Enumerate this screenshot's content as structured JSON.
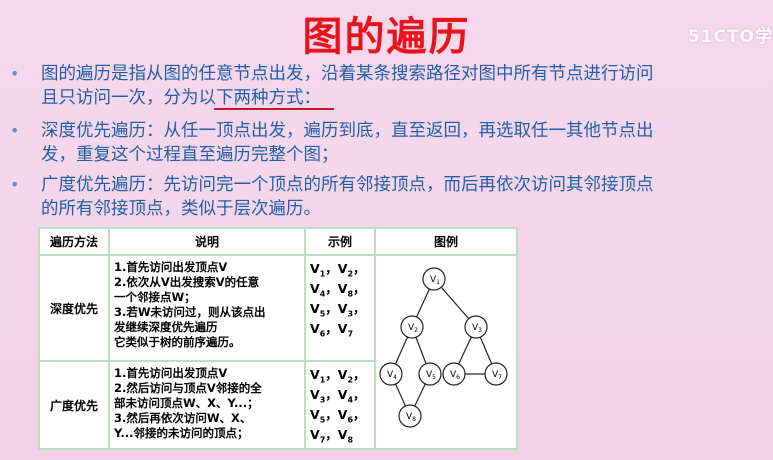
{
  "title": "图的遍历",
  "watermark": "51CTO学",
  "bullets": [
    {
      "line1": "图的遍历是指从图的任意节点出发，沿着某条搜索路径对图中所有节点进行访问",
      "line2": "且只访问一次，分为以下两种方式："
    },
    {
      "line1": "深度优先遍历：从任一顶点出发，遍历到底，直至返回，再选取任一其他节点出",
      "line2": "发，重复这个过程直至遍历完整个图；"
    },
    {
      "line1": "广度优先遍历：先访问完一个顶点的所有邻接顶点，而后再依次访问其邻接顶点",
      "line2": "的所有邻接顶点，类似于层次遍历。"
    }
  ],
  "table": {
    "headers": [
      "遍历方法",
      "说明",
      "示例",
      "图例"
    ],
    "rows": [
      {
        "method": "深度优先",
        "desc": [
          "1.首先访问出发顶点V",
          "2.依次从V出发搜索V的任意",
          "一个邻接点W；",
          "3.若W未访问过，则从该点出",
          "发继续深度优先遍历",
          "它类似于树的前序遍历。"
        ],
        "example": [
          "V1，V2，",
          "V4，V8，",
          "V5，V3，",
          "V6，V7"
        ]
      },
      {
        "method": "广度优先",
        "desc": [
          "1.首先访问出发顶点V",
          "2.然后访问与顶点V邻接的全",
          "部未访问顶点W、X、Y...；",
          "3.然后再依次访问W、X、",
          "Y...邻接的未访问的顶点；"
        ],
        "example": [
          "V1，V2，",
          "V3，V4，",
          "V5，V6，",
          "V7，V8"
        ]
      }
    ]
  },
  "graph": {
    "nodes": [
      {
        "id": "V1",
        "base": "V",
        "sub": "1"
      },
      {
        "id": "V2",
        "base": "V",
        "sub": "2"
      },
      {
        "id": "V3",
        "base": "V",
        "sub": "3"
      },
      {
        "id": "V4",
        "base": "V",
        "sub": "4"
      },
      {
        "id": "V5",
        "base": "V",
        "sub": "5"
      },
      {
        "id": "V6",
        "base": "V",
        "sub": "6"
      },
      {
        "id": "V7",
        "base": "V",
        "sub": "7"
      },
      {
        "id": "V8",
        "base": "V",
        "sub": "8"
      }
    ],
    "edges": [
      [
        "V1",
        "V2"
      ],
      [
        "V1",
        "V3"
      ],
      [
        "V2",
        "V4"
      ],
      [
        "V2",
        "V5"
      ],
      [
        "V4",
        "V8"
      ],
      [
        "V5",
        "V8"
      ],
      [
        "V3",
        "V6"
      ],
      [
        "V3",
        "V7"
      ],
      [
        "V6",
        "V7"
      ]
    ]
  }
}
